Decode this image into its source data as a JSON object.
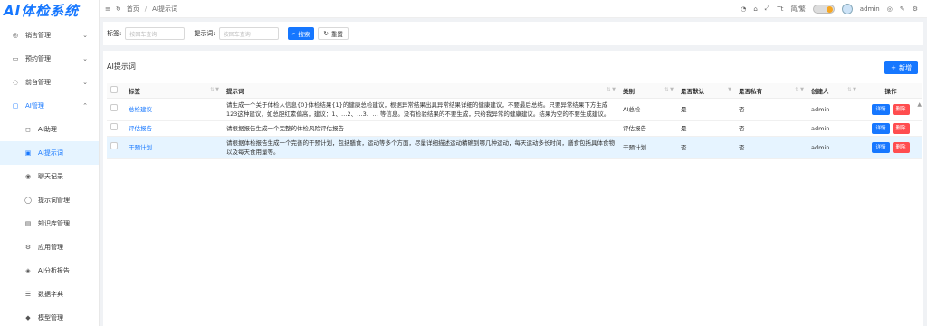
{
  "app": {
    "title": "AI体检系统"
  },
  "sidebar": {
    "items": [
      {
        "label": "销售管理",
        "icon": "sales-icon",
        "glyph": "◎",
        "chevron": "⌄"
      },
      {
        "label": "预约管理",
        "icon": "calendar-icon",
        "glyph": "▭",
        "chevron": "⌄"
      },
      {
        "label": "前台管理",
        "icon": "desk-icon",
        "glyph": "◌",
        "chevron": "⌄"
      },
      {
        "label": "AI管理",
        "icon": "ai-icon",
        "glyph": "▢",
        "chevron": "⌃"
      }
    ],
    "subitems": [
      {
        "label": "AI助理",
        "icon": "assistant-icon",
        "glyph": "◻"
      },
      {
        "label": "AI提示词",
        "icon": "prompt-icon",
        "glyph": "▣"
      },
      {
        "label": "聊天记录",
        "icon": "chat-icon",
        "glyph": "◉"
      },
      {
        "label": "提示词管理",
        "icon": "bulb-icon",
        "glyph": "◯"
      },
      {
        "label": "知识库管理",
        "icon": "book-icon",
        "glyph": "▤"
      },
      {
        "label": "应用管理",
        "icon": "app-icon",
        "glyph": "⚙"
      },
      {
        "label": "AI分析报告",
        "icon": "report-icon",
        "glyph": "◈"
      },
      {
        "label": "数据字典",
        "icon": "list-icon",
        "glyph": "☰"
      },
      {
        "label": "模型管理",
        "icon": "model-icon",
        "glyph": "◆"
      }
    ]
  },
  "topnav": {
    "menu_glyph": "≡",
    "refresh_glyph": "↻",
    "breadcrumb_home": "首页",
    "breadcrumb_sep": "/",
    "breadcrumb_current": "AI提示词",
    "icons": [
      "◔",
      "⌂",
      "⤢",
      "Tt",
      "⚙"
    ],
    "lang": "简/繁",
    "username": "admin",
    "right_icons": [
      "◎",
      "✎",
      "⚙"
    ]
  },
  "search": {
    "tag_label": "标签:",
    "tag_placeholder": "按回车查询",
    "prompt_label": "提示词:",
    "prompt_placeholder": "按回车查询",
    "search_label": "搜索",
    "reset_label": "重置"
  },
  "table": {
    "title": "AI提示词",
    "add_label": "新增",
    "columns": [
      "标签",
      "提示词",
      "类别",
      "是否默认",
      "是否私有",
      "创建人",
      "操作"
    ],
    "rows": [
      {
        "tag": "总检建议",
        "prompt": "请生成一个关于体检人信息{0}体检结果{1}的健康总检建议，根据异常结果出具异常结果详细的健康建议，不要最后总结。只要异常结果下方生成123这种建议，如总胆红素偏高，建议：1、…2、…3、… 等信息。没有检验结果的不要生成，只给我异常的健康建议。结果为空的不要生成建议。",
        "category": "AI总检",
        "is_default": "是",
        "is_private": "否",
        "creator": "admin"
      },
      {
        "tag": "评估报告",
        "prompt": "请根据报告生成一个完整的体检风险评估报告",
        "category": "评估报告",
        "is_default": "是",
        "is_private": "否",
        "creator": "admin"
      },
      {
        "tag": "干预计划",
        "prompt": "请根据体检报告生成一个完善的干预计划，包括膳食，运动等多个方面，尽量详细描述运动精确到哪几种运动，每天运动多长时间，膳食包括具体食物以及每天食用量等。",
        "category": "干预计划",
        "is_default": "否",
        "is_private": "否",
        "creator": "admin"
      }
    ],
    "op_detail": "详情",
    "op_delete": "删除"
  }
}
